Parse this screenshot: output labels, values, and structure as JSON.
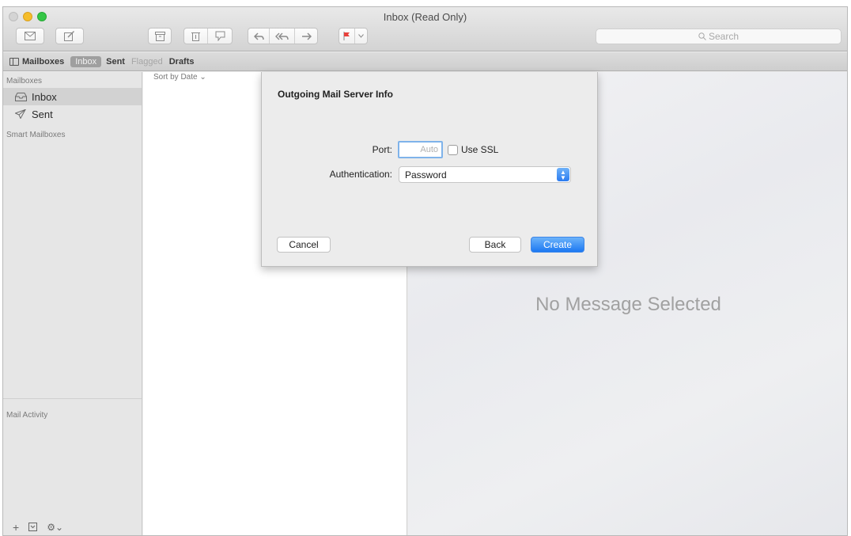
{
  "window": {
    "title": "Inbox (Read Only)"
  },
  "toolbar": {
    "search_placeholder": "Search",
    "icons": [
      "get-mail-icon",
      "compose-icon",
      "archive-icon",
      "delete-icon",
      "junk-icon",
      "reply-icon",
      "reply-all-icon",
      "forward-icon",
      "flag-icon"
    ],
    "flag_color": "#e8413c"
  },
  "favorites": {
    "mailboxes_label": "Mailboxes",
    "inbox_label": "Inbox",
    "sent_label": "Sent",
    "flagged_label": "Flagged",
    "drafts_label": "Drafts"
  },
  "sidebar": {
    "mailboxes_header": "Mailboxes",
    "items": [
      {
        "label": "Inbox",
        "icon": "inbox-icon",
        "selected": true
      },
      {
        "label": "Sent",
        "icon": "sent-icon",
        "selected": false
      }
    ],
    "smart_mailboxes_header": "Smart Mailboxes",
    "mail_activity_header": "Mail Activity",
    "bottom_icons": [
      "add-icon",
      "show-hide-icon",
      "gear-icon"
    ]
  },
  "message_list": {
    "sort_label": "Sort by Date"
  },
  "viewer": {
    "empty_text": "No Message Selected"
  },
  "dialog": {
    "title": "Outgoing Mail Server Info",
    "port_label": "Port:",
    "port_placeholder": "Auto",
    "ssl_label": "Use SSL",
    "ssl_checked": false,
    "auth_label": "Authentication:",
    "auth_value": "Password",
    "cancel_label": "Cancel",
    "back_label": "Back",
    "create_label": "Create"
  },
  "colors": {
    "accent": "#2b7bf0",
    "traffic_close": "#d4d4d4",
    "traffic_minimize": "#f5bd2a",
    "traffic_zoom": "#35c646"
  }
}
